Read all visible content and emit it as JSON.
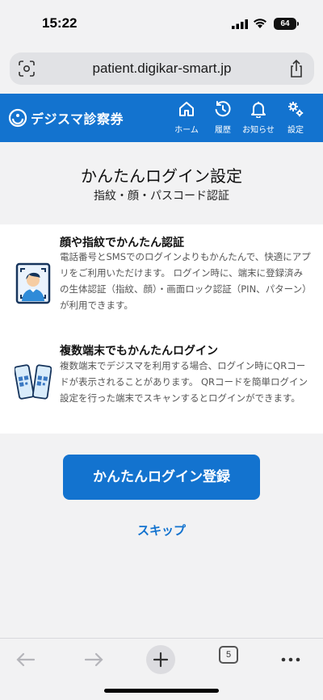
{
  "status": {
    "time": "15:22",
    "battery": "64"
  },
  "browser": {
    "url": "patient.digikar-smart.jp",
    "tabs_count": "5"
  },
  "header": {
    "logo_text": "デジスマ診察券",
    "nav": [
      {
        "label": "ホーム",
        "icon": "home-icon"
      },
      {
        "label": "履歴",
        "icon": "history-icon"
      },
      {
        "label": "お知らせ",
        "icon": "bell-icon"
      },
      {
        "label": "設定",
        "icon": "gear-icon"
      }
    ]
  },
  "page": {
    "title": "かんたんログイン設定",
    "subtitle": "指紋・顔・パスコード認証"
  },
  "features": [
    {
      "title": "顔や指紋でかんたん認証",
      "description": "電話番号とSMSでのログインよりもかんたんで、快適にアプリをご利用いただけます。 ログイン時に、端末に登録済みの生体認証（指紋、顔）・画面ロック認証（PIN、パターン）が利用できます。",
      "icon": "face-id-illustration"
    },
    {
      "title": "複数端末でもかんたんログイン",
      "description": "複数端末でデジスマを利用する場合、ログイン時にQRコードが表示されることがあります。 QRコードを簡単ログイン設定を行った端末でスキャンするとログインができます。",
      "icon": "qr-phones-illustration"
    }
  ],
  "actions": {
    "register_label": "かんたんログイン登録",
    "skip_label": "スキップ"
  },
  "colors": {
    "brand": "#1373cf",
    "background": "#f2f2f3"
  }
}
